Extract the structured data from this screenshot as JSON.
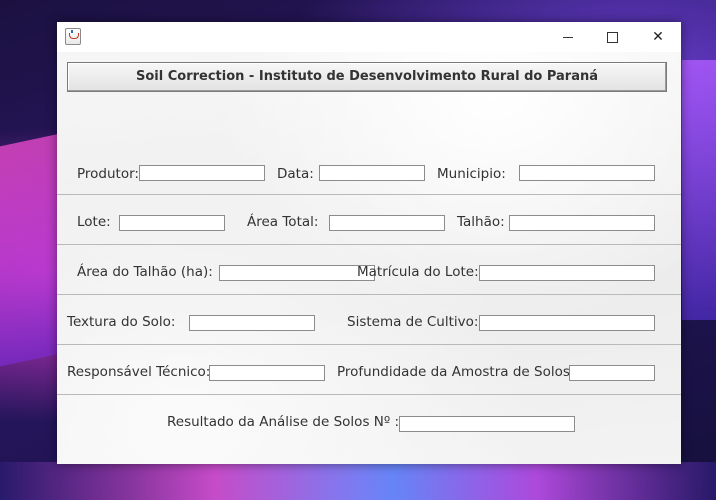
{
  "window": {
    "controls": {
      "minimize": "minimize-icon",
      "maximize": "maximize-icon",
      "close": "close-icon"
    },
    "close_glyph": "✕"
  },
  "header": {
    "title": "Soil Correction -  Instituto de Desenvolvimento Rural do Paraná"
  },
  "form": {
    "produtor": {
      "label": "Produtor:",
      "value": ""
    },
    "data": {
      "label": "Data:",
      "value": ""
    },
    "municipio": {
      "label": "Municipio:",
      "value": ""
    },
    "lote": {
      "label": "Lote:",
      "value": ""
    },
    "area_total": {
      "label": "Área Total:",
      "value": ""
    },
    "talhao": {
      "label": "Talhão:",
      "value": ""
    },
    "area_talhao": {
      "label": "Área do Talhão (ha):",
      "value": ""
    },
    "matricula": {
      "label": "Matrícula do Lote:",
      "value": ""
    },
    "textura": {
      "label": "Textura do Solo:",
      "value": ""
    },
    "sistema": {
      "label": "Sistema de Cultivo:",
      "value": ""
    },
    "responsavel": {
      "label": "Responsável Técnico:",
      "value": ""
    },
    "profundidade": {
      "label": "Profundidade da Amostra de Solos:",
      "value": ""
    },
    "resultado": {
      "label": "Resultado da Análise de Solos Nº :",
      "value": ""
    }
  }
}
